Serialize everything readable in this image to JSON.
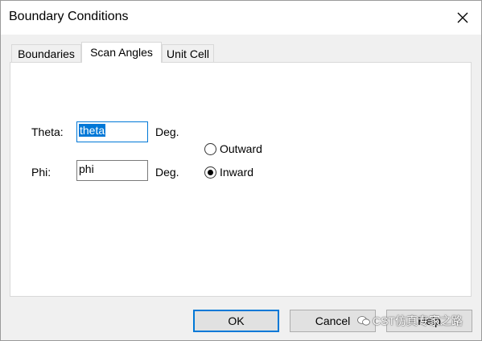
{
  "window": {
    "title": "Boundary Conditions"
  },
  "tabs": [
    {
      "label": "Boundaries",
      "active": false
    },
    {
      "label": "Scan Angles",
      "active": true
    },
    {
      "label": "Unit Cell",
      "active": false
    }
  ],
  "scan_angles": {
    "theta": {
      "label": "Theta:",
      "value": "theta",
      "unit": "Deg."
    },
    "phi": {
      "label": "Phi:",
      "value": "phi",
      "unit": "Deg."
    },
    "direction": {
      "options": [
        {
          "label": "Outward",
          "checked": false
        },
        {
          "label": "Inward",
          "checked": true
        }
      ]
    }
  },
  "buttons": {
    "ok": "OK",
    "cancel": "Cancel",
    "help": "Help"
  },
  "watermark": {
    "text": "CST仿真专家之路"
  }
}
